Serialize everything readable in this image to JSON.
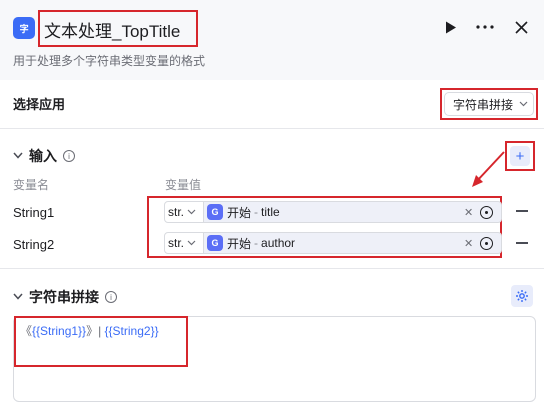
{
  "header": {
    "app_icon_text": "字",
    "title": "文本处理_TopTitle",
    "description": "用于处理多个字符串类型变量的格式"
  },
  "select_app": {
    "label": "选择应用",
    "value": "字符串拼接"
  },
  "input_section": {
    "label": "输入",
    "col_name": "变量名",
    "col_value": "变量值",
    "rows": [
      {
        "name": "String1",
        "type": "str.",
        "ref_node": "开始",
        "ref_sep": "-",
        "ref_field": "title"
      },
      {
        "name": "String2",
        "type": "str.",
        "ref_node": "开始",
        "ref_sep": "-",
        "ref_field": "author"
      }
    ]
  },
  "concat_section": {
    "label": "字符串拼接",
    "template_open": "《",
    "template_var1": "{{String1}}",
    "template_mid": "》| ",
    "template_var2": "{{String2}}"
  },
  "colors": {
    "accent": "#3b6cf6",
    "highlight": "#d6262c"
  }
}
